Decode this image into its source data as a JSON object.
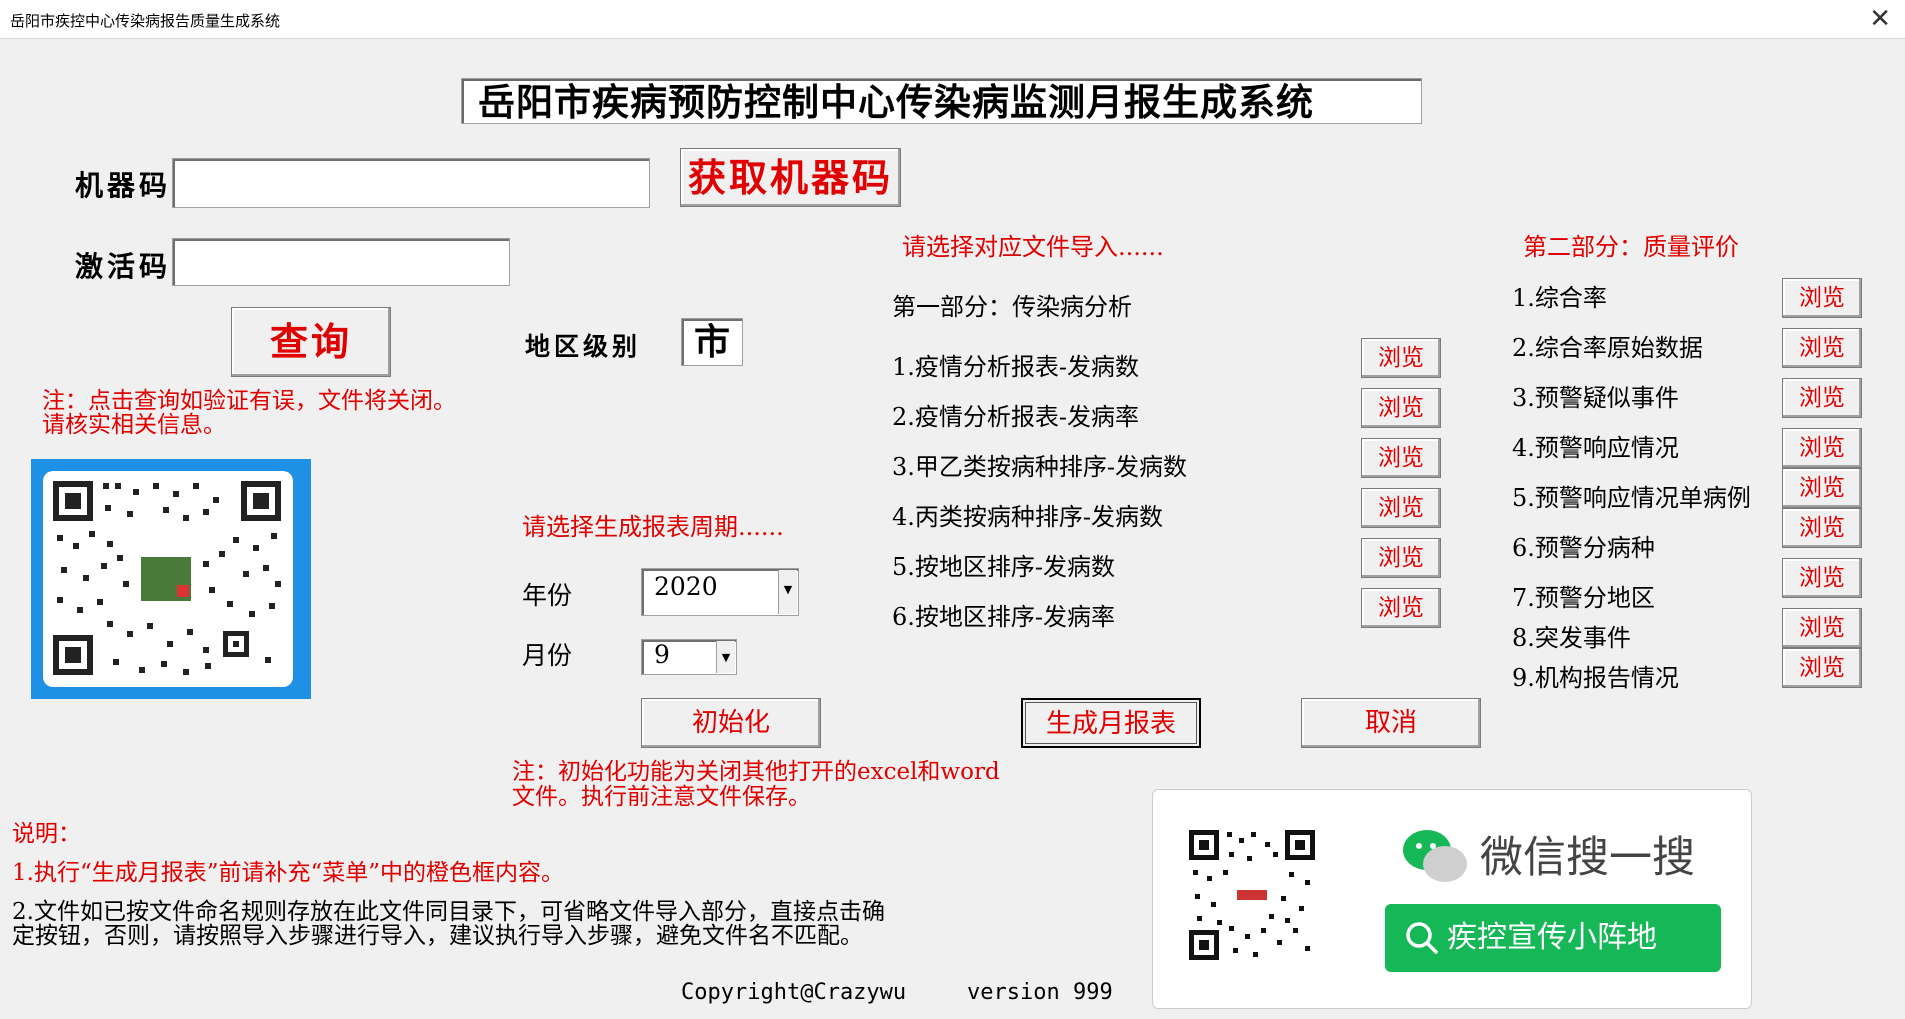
{
  "window": {
    "title": "岳阳市疾控中心传染病报告质量生成系统",
    "close_glyph": "✕"
  },
  "banner": {
    "title": "岳阳市疾病预防控制中心传染病监测月报生成系统"
  },
  "license": {
    "machine_code_label": "机器码",
    "machine_code_value": "",
    "activation_code_label": "激活码",
    "activation_code_value": "",
    "get_code_button": "获取机器码",
    "query_button": "查询",
    "warning_line1": "注：点击查询如验证有误，文件将关闭。",
    "warning_line2": "请核实相关信息。"
  },
  "region": {
    "label": "地区级别",
    "value": "市"
  },
  "period": {
    "prompt": "请选择生成报表周期......",
    "year_label": "年份",
    "year_value": "2020",
    "month_label": "月份",
    "month_value": "9"
  },
  "import": {
    "prompt": "请选择对应文件导入......",
    "part1_title": "第一部分：传染病分析",
    "part1_items": [
      {
        "label": "1.疫情分析报表-发病数",
        "button": "浏览"
      },
      {
        "label": "2.疫情分析报表-发病率",
        "button": "浏览"
      },
      {
        "label": "3.甲乙类按病种排序-发病数",
        "button": "浏览"
      },
      {
        "label": "4.丙类按病种排序-发病数",
        "button": "浏览"
      },
      {
        "label": "5.按地区排序-发病数",
        "button": "浏览"
      },
      {
        "label": "6.按地区排序-发病率",
        "button": "浏览"
      }
    ],
    "part2_title": "第二部分：质量评价",
    "part2_items": [
      {
        "label": "1.综合率",
        "button": "浏览"
      },
      {
        "label": "2.综合率原始数据",
        "button": "浏览"
      },
      {
        "label": "3.预警疑似事件",
        "button": "浏览"
      },
      {
        "label": "4.预警响应情况",
        "button": "浏览"
      },
      {
        "label": "5.预警响应情况单病例",
        "button": "浏览"
      },
      {
        "label": "6.预警分病种",
        "button": "浏览"
      },
      {
        "label": "7.预警分地区",
        "button": "浏览"
      },
      {
        "label": "8.突发事件",
        "button": "浏览"
      },
      {
        "label": "9.机构报告情况",
        "button": "浏览"
      }
    ]
  },
  "actions": {
    "init": "初始化",
    "generate": "生成月报表",
    "cancel": "取消"
  },
  "init_note": {
    "line1": "注：初始化功能为关闭其他打开的excel和word",
    "line2": "文件。执行前注意文件保存。"
  },
  "instructions": {
    "title": "说明：",
    "line1": "1.执行“生成月报表”前请补充“菜单”中的橙色框内容。",
    "line2a": "2.文件如已按文件命名规则存放在此文件同目录下，可省略文件导入部分，直接点击确",
    "line2b": "定按钮，否则，请按照导入步骤进行导入，建议执行导入步骤，避免文件名不匹配。"
  },
  "footer": {
    "copyright": "Copyright@Crazywu",
    "version": "version 999"
  },
  "wechat": {
    "search_text": "微信搜一搜",
    "account": "疾控宣传小阵地",
    "icons": [
      "wechat-icon",
      "search-icon",
      "qr-code"
    ]
  },
  "colors": {
    "accent_red": "#e00000",
    "wechat_green": "#15b757",
    "qr_frame_blue": "#1e90e6"
  }
}
